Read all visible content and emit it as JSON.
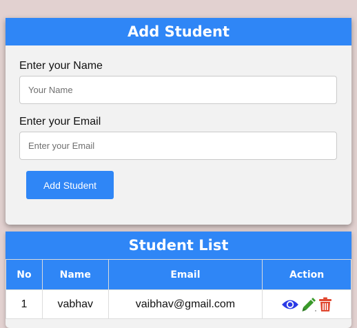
{
  "form": {
    "title": "Add Student",
    "name_label": "Enter your Name",
    "name_placeholder": "Your Name",
    "email_label": "Enter your Email",
    "email_placeholder": "Enter your Email",
    "submit_label": "Add Student"
  },
  "list": {
    "title": "Student List",
    "columns": [
      "No",
      "Name",
      "Email",
      "Action"
    ],
    "rows": [
      {
        "no": "1",
        "name": "vabhav",
        "email": "vaibhav@gmail.com",
        "actions": [
          "eye-icon",
          "pencil-icon",
          "trash-icon"
        ]
      }
    ]
  },
  "colors": {
    "accent": "#2f86f6",
    "view_icon": "#2b3be6",
    "edit_icon": "#3a9a2a",
    "delete_icon": "#e0472f",
    "page_background": "#e2d1d0"
  }
}
